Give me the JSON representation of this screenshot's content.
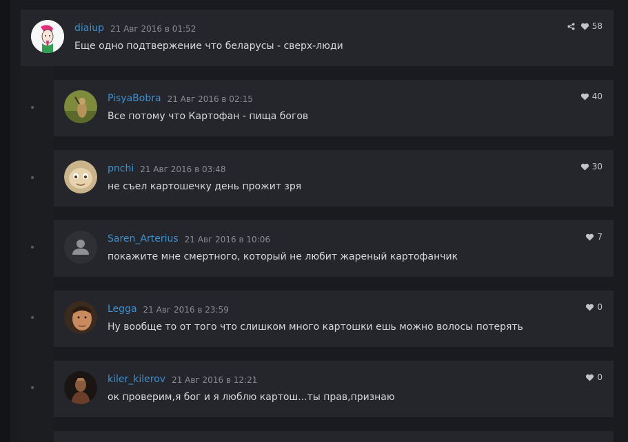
{
  "comments": [
    {
      "author": "diaiup",
      "date": "21 Авг 2016 в 01:52",
      "text": "Еще одно подтвержение что беларусы - сверх-люди",
      "likes": "58"
    },
    {
      "author": "PisyaBobra",
      "date": "21 Авг 2016 в 02:15",
      "text": "Все потому что Картофан - пища богов",
      "likes": "40"
    },
    {
      "author": "pnchi",
      "date": "21 Авг 2016 в 03:48",
      "text": "не съел картошечку день прожит зря",
      "likes": "30"
    },
    {
      "author": "Saren_Arterius",
      "date": "21 Авг 2016 в 10:06",
      "text": "покажите мне смертного, который не любит жареный картофанчик",
      "likes": "7"
    },
    {
      "author": "Legga",
      "date": "21 Авг 2016 в 23:59",
      "text": "Ну вообще то от того что слишком много картошки ешь можно волосы потерять",
      "likes": "0"
    },
    {
      "author": "kiler_kilerov",
      "date": "21 Авг 2016 в 12:21",
      "text": "ок проверим,я бог и я люблю картош...ты прав,признаю",
      "likes": "0"
    }
  ],
  "colors": {
    "background": "#131417",
    "card": "#25262c",
    "author": "#3d91cf",
    "text": "#d6d7da"
  },
  "icons": {
    "share": "share-icon",
    "like": "heart-icon",
    "default_avatar": "user-silhouette-icon"
  }
}
